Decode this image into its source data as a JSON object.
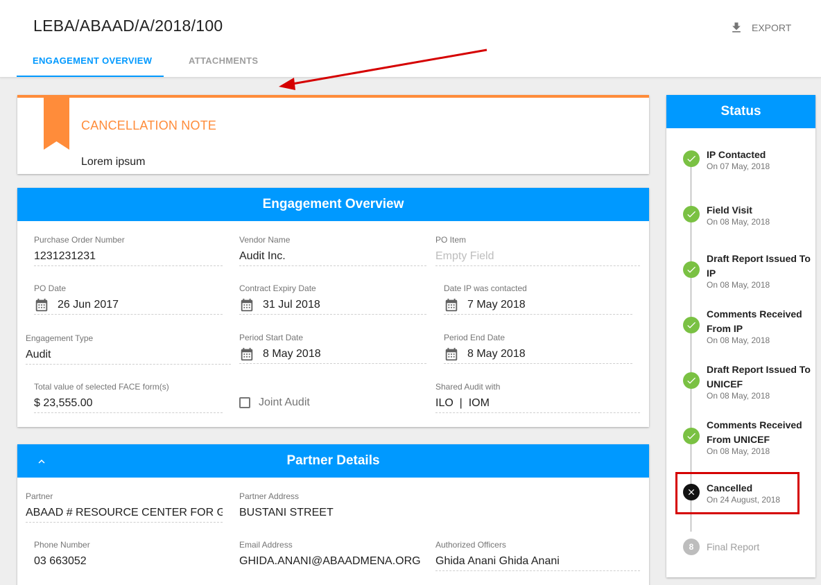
{
  "header": {
    "title": "LEBA/ABAAD/A/2018/100",
    "export_label": "EXPORT",
    "tabs": [
      {
        "label": "ENGAGEMENT OVERVIEW",
        "active": true
      },
      {
        "label": "ATTACHMENTS",
        "active": false
      }
    ]
  },
  "cancellation": {
    "title": "CANCELLATION NOTE",
    "text": "Lorem ipsum",
    "accent_color": "#ff8c3a"
  },
  "engagement": {
    "title": "Engagement Overview",
    "purchase_order": {
      "label": "Purchase Order Number",
      "value": "1231231231"
    },
    "vendor": {
      "label": "Vendor Name",
      "value": "Audit Inc."
    },
    "po_item": {
      "label": "PO Item",
      "placeholder": "Empty Field"
    },
    "po_date": {
      "label": "PO Date",
      "value": "26 Jun 2017"
    },
    "contract_expiry": {
      "label": "Contract Expiry Date",
      "value": "31 Jul 2018"
    },
    "date_ip_contacted": {
      "label": "Date IP was contacted",
      "value": "7 May 2018"
    },
    "engagement_type": {
      "label": "Engagement Type",
      "value": "Audit"
    },
    "period_start": {
      "label": "Period Start Date",
      "value": "8 May 2018"
    },
    "period_end": {
      "label": "Period End Date",
      "value": "8 May 2018"
    },
    "face_total": {
      "label": "Total value of selected FACE form(s)",
      "value": "$ 23,555.00"
    },
    "joint_audit": {
      "label": "Joint Audit",
      "checked": false
    },
    "shared_audit": {
      "label": "Shared Audit with",
      "value": "ILO  |  IOM"
    }
  },
  "partner": {
    "title": "Partner Details",
    "partner": {
      "label": "Partner",
      "value": "ABAAD # RESOURCE CENTER FOR GENDER EQUALITY"
    },
    "address": {
      "label": "Partner Address",
      "value": "BUSTANI STREET"
    },
    "phone": {
      "label": "Phone Number",
      "value": "03 663052"
    },
    "email": {
      "label": "Email Address",
      "value": "GHIDA.ANANI@ABAADMENA.ORG"
    },
    "officers": {
      "label": "Authorized Officers",
      "value": "Ghida Anani Ghida Anani"
    }
  },
  "status": {
    "title": "Status",
    "steps": [
      {
        "title": "IP Contacted",
        "date": "On 07 May, 2018",
        "state": "done"
      },
      {
        "title": "Field Visit",
        "date": "On 08 May, 2018",
        "state": "done"
      },
      {
        "title": "Draft Report Issued To IP",
        "date": "On 08 May, 2018",
        "state": "done"
      },
      {
        "title": "Comments Received From IP",
        "date": "On 08 May, 2018",
        "state": "done"
      },
      {
        "title": "Draft Report Issued To UNICEF",
        "date": "On 08 May, 2018",
        "state": "done"
      },
      {
        "title": "Comments Received From UNICEF",
        "date": "On 08 May, 2018",
        "state": "done"
      },
      {
        "title": "Cancelled",
        "date": "On 24 August, 2018",
        "state": "cancelled"
      },
      {
        "title": "Final Report",
        "number": "8",
        "state": "pending"
      }
    ]
  },
  "colors": {
    "primary": "#0099ff",
    "success": "#7ac143",
    "annotation": "#d50000"
  }
}
